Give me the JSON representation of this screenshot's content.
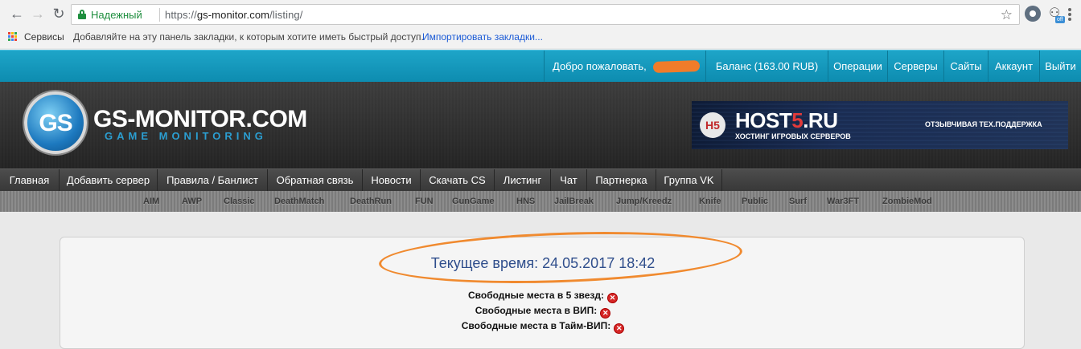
{
  "browser": {
    "secure_label": "Надежный",
    "url_scheme": "https://",
    "url_host": "gs-monitor.com",
    "url_path": "/listing/",
    "ext_badge": "off",
    "bookmarks": {
      "services": "Сервисы",
      "hint": "Добавляйте на эту панель закладки, к которым хотите иметь быстрый доступ.",
      "import": "Импортировать закладки..."
    }
  },
  "topbar": {
    "welcome": "Добро пожаловать,",
    "balance": "Баланс (163.00 RUB)",
    "operations": "Операции",
    "servers": "Серверы",
    "sites": "Сайты",
    "account": "Аккаунт",
    "logout": "Выйти"
  },
  "header": {
    "logo_text": "GS",
    "brand": "GS-MONITOR.COM",
    "tagline": "GAME MONITORING",
    "banner": {
      "badge": "H5",
      "title_a": "HOST",
      "title_b": "5",
      "title_c": ".RU",
      "subtitle": "ХОСТИНГ ИГРОВЫХ СЕРВЕРОВ",
      "right_text": "ОТЗЫВЧИВАЯ ТЕХ.ПОДДЕРЖКА"
    }
  },
  "nav": [
    "Главная",
    "Добавить сервер",
    "Правила / Банлист",
    "Обратная связь",
    "Новости",
    "Скачать CS",
    "Листинг",
    "Чат",
    "Партнерка",
    "Группа VK"
  ],
  "categories": [
    "AIM",
    "AWP",
    "Classic",
    "DeathMatch",
    "DeathRun",
    "FUN",
    "GunGame",
    "HNS",
    "JailBreak",
    "Jump/Kreedz",
    "Knife",
    "Public",
    "Surf",
    "War3FT",
    "ZombieMod"
  ],
  "content": {
    "current_time": "Текущее время: 24.05.2017 18:42",
    "free5": "Свободные места в 5 звезд:",
    "freevip": "Свободные места в ВИП:",
    "freetimevip": "Свободные места в Тайм-ВИП:"
  },
  "colors": {
    "topbar": "#1399bd",
    "link": "#1a5ad6",
    "secure": "#1e8e3e",
    "annotation": "#f08a2f",
    "status_none": "#d62626"
  }
}
